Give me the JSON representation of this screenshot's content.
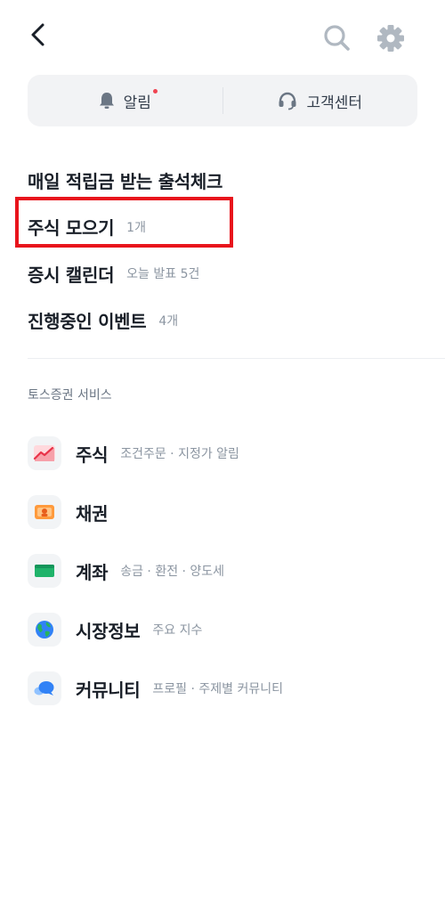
{
  "header": {
    "back_icon": "chevron-left-icon",
    "search_icon": "search-icon",
    "settings_icon": "gear-icon"
  },
  "quick_bar": {
    "notifications_label": "알림",
    "support_label": "고객센터",
    "notification_dot_color": "#f04452"
  },
  "menu": {
    "items": [
      {
        "title": "매일 적립금 받는 출석체크",
        "sub": ""
      },
      {
        "title": "주식 모으기",
        "sub": "1개"
      },
      {
        "title": "증시 캘린더",
        "sub": "오늘 발표 5건"
      },
      {
        "title": "진행중인 이벤트",
        "sub": "4개"
      }
    ]
  },
  "services": {
    "section_title": "토스증권 서비스",
    "items": [
      {
        "title": "주식",
        "sub": "조건주문 · 지정가 알림",
        "icon": "stock-chart-icon"
      },
      {
        "title": "채권",
        "sub": "",
        "icon": "bond-icon"
      },
      {
        "title": "계좌",
        "sub": "송금 · 환전 · 양도세",
        "icon": "account-card-icon"
      },
      {
        "title": "시장정보",
        "sub": "주요 지수",
        "icon": "globe-icon"
      },
      {
        "title": "커뮤니티",
        "sub": "프로필 · 주제별 커뮤니티",
        "icon": "chat-bubble-icon"
      }
    ]
  },
  "colors": {
    "highlight_border": "#e8141c",
    "background": "#ffffff",
    "quickbar_bg": "#f2f3f5"
  }
}
